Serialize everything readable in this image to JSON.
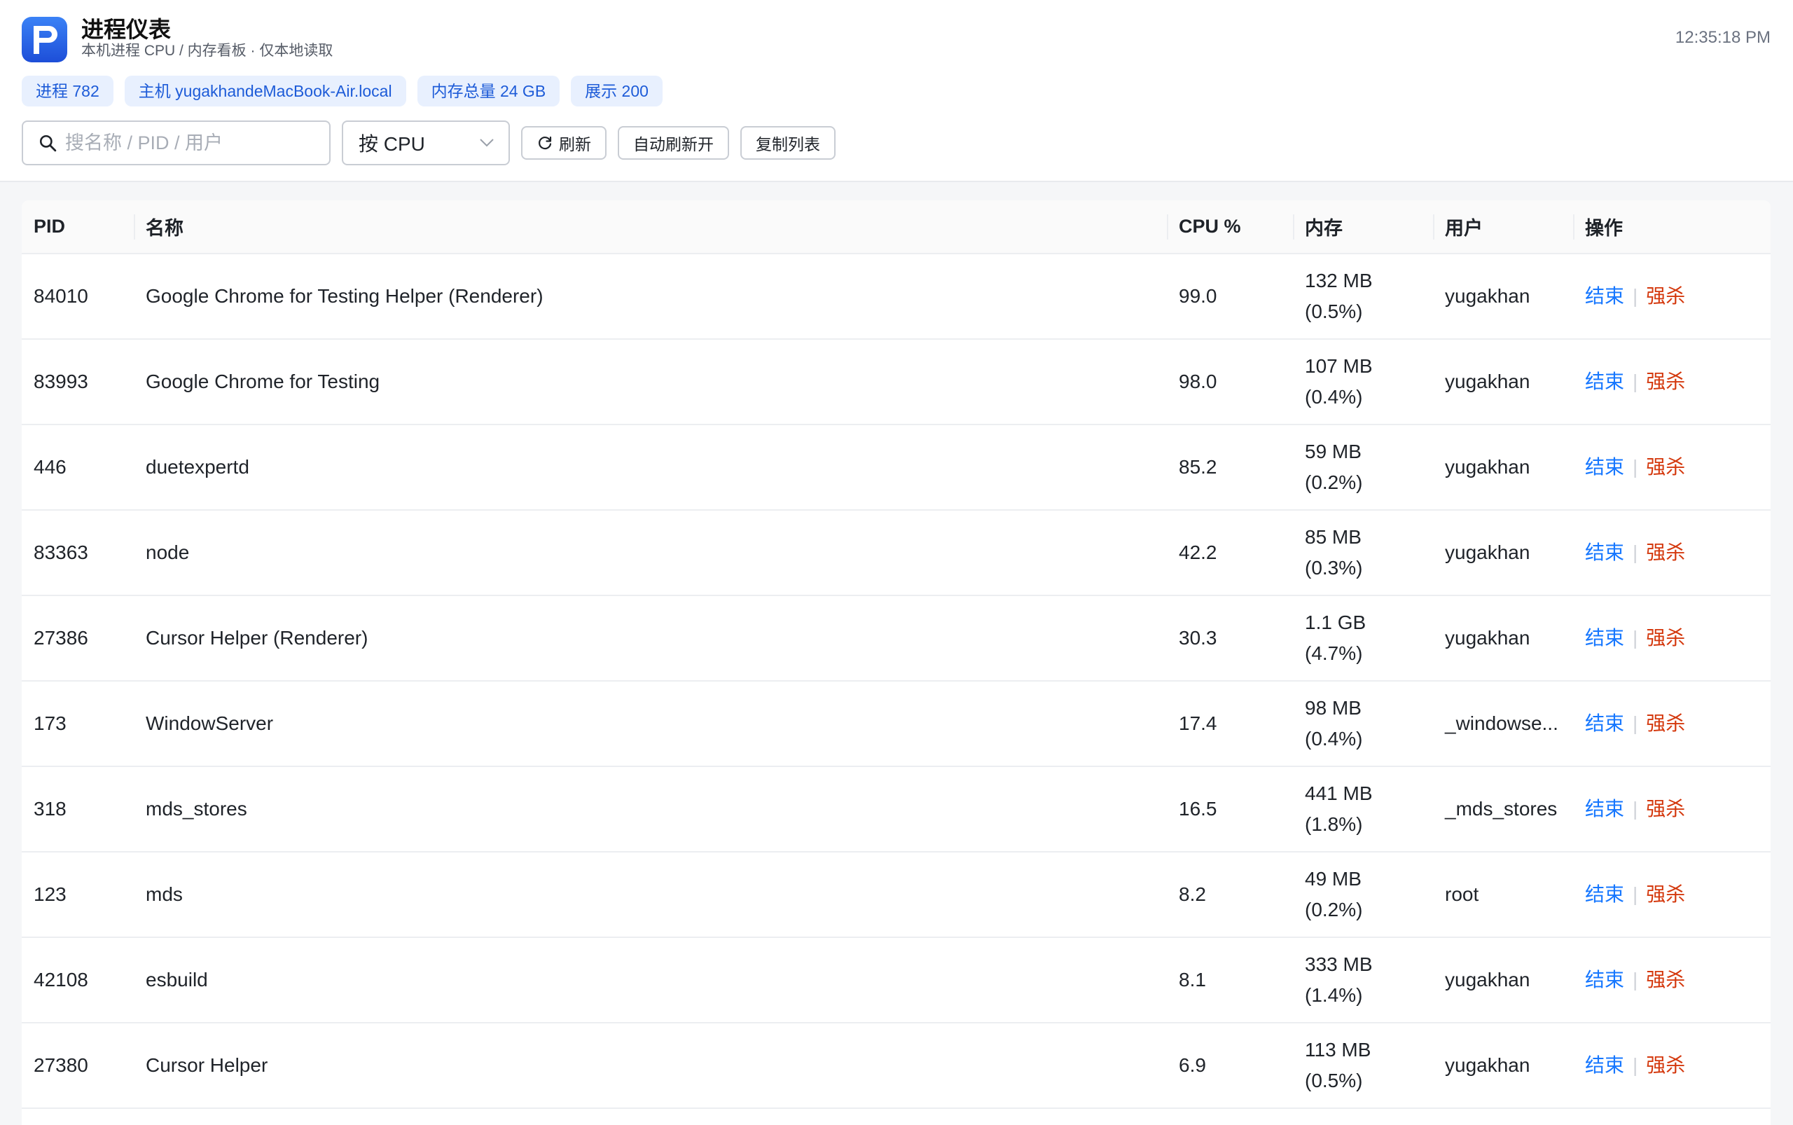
{
  "app": {
    "title": "进程仪表",
    "subtitle": "本机进程 CPU / 内存看板 · 仅本地读取",
    "clock": "12:35:18 PM",
    "accent_color": "#1d5bd8",
    "logo_icon": "app-logo-icon"
  },
  "badges": [
    {
      "label": "进程 782"
    },
    {
      "label": "主机 yugakhandeMacBook-Air.local"
    },
    {
      "label": "内存总量 24 GB"
    },
    {
      "label": "展示 200"
    }
  ],
  "toolbar": {
    "search_placeholder": "搜名称 / PID / 用户",
    "search_value": "",
    "sort_selected": "按 CPU",
    "refresh_label": "刷新",
    "auto_refresh_label": "自动刷新开",
    "copy_label": "复制列表"
  },
  "table": {
    "columns": [
      "PID",
      "名称",
      "CPU %",
      "内存",
      "用户",
      "操作"
    ],
    "action_end": "结束",
    "action_kill": "强杀",
    "action_sep": "|",
    "rows": [
      {
        "pid": "84010",
        "name": "Google Chrome for Testing Helper (Renderer)",
        "cpu": "99.0",
        "mem": "132 MB",
        "mem_pct": "(0.5%)",
        "user": "yugakhan"
      },
      {
        "pid": "83993",
        "name": "Google Chrome for Testing",
        "cpu": "98.0",
        "mem": "107 MB",
        "mem_pct": "(0.4%)",
        "user": "yugakhan"
      },
      {
        "pid": "446",
        "name": "duetexpertd",
        "cpu": "85.2",
        "mem": "59 MB",
        "mem_pct": "(0.2%)",
        "user": "yugakhan"
      },
      {
        "pid": "83363",
        "name": "node",
        "cpu": "42.2",
        "mem": "85 MB",
        "mem_pct": "(0.3%)",
        "user": "yugakhan"
      },
      {
        "pid": "27386",
        "name": "Cursor Helper (Renderer)",
        "cpu": "30.3",
        "mem": "1.1 GB",
        "mem_pct": "(4.7%)",
        "user": "yugakhan"
      },
      {
        "pid": "173",
        "name": "WindowServer",
        "cpu": "17.4",
        "mem": "98 MB",
        "mem_pct": "(0.4%)",
        "user": "_windowse..."
      },
      {
        "pid": "318",
        "name": "mds_stores",
        "cpu": "16.5",
        "mem": "441 MB",
        "mem_pct": "(1.8%)",
        "user": "_mds_stores"
      },
      {
        "pid": "123",
        "name": "mds",
        "cpu": "8.2",
        "mem": "49 MB",
        "mem_pct": "(0.2%)",
        "user": "root"
      },
      {
        "pid": "42108",
        "name": "esbuild",
        "cpu": "8.1",
        "mem": "333 MB",
        "mem_pct": "(1.4%)",
        "user": "yugakhan"
      },
      {
        "pid": "27380",
        "name": "Cursor Helper",
        "cpu": "6.9",
        "mem": "113 MB",
        "mem_pct": "(0.5%)",
        "user": "yugakhan"
      }
    ]
  }
}
